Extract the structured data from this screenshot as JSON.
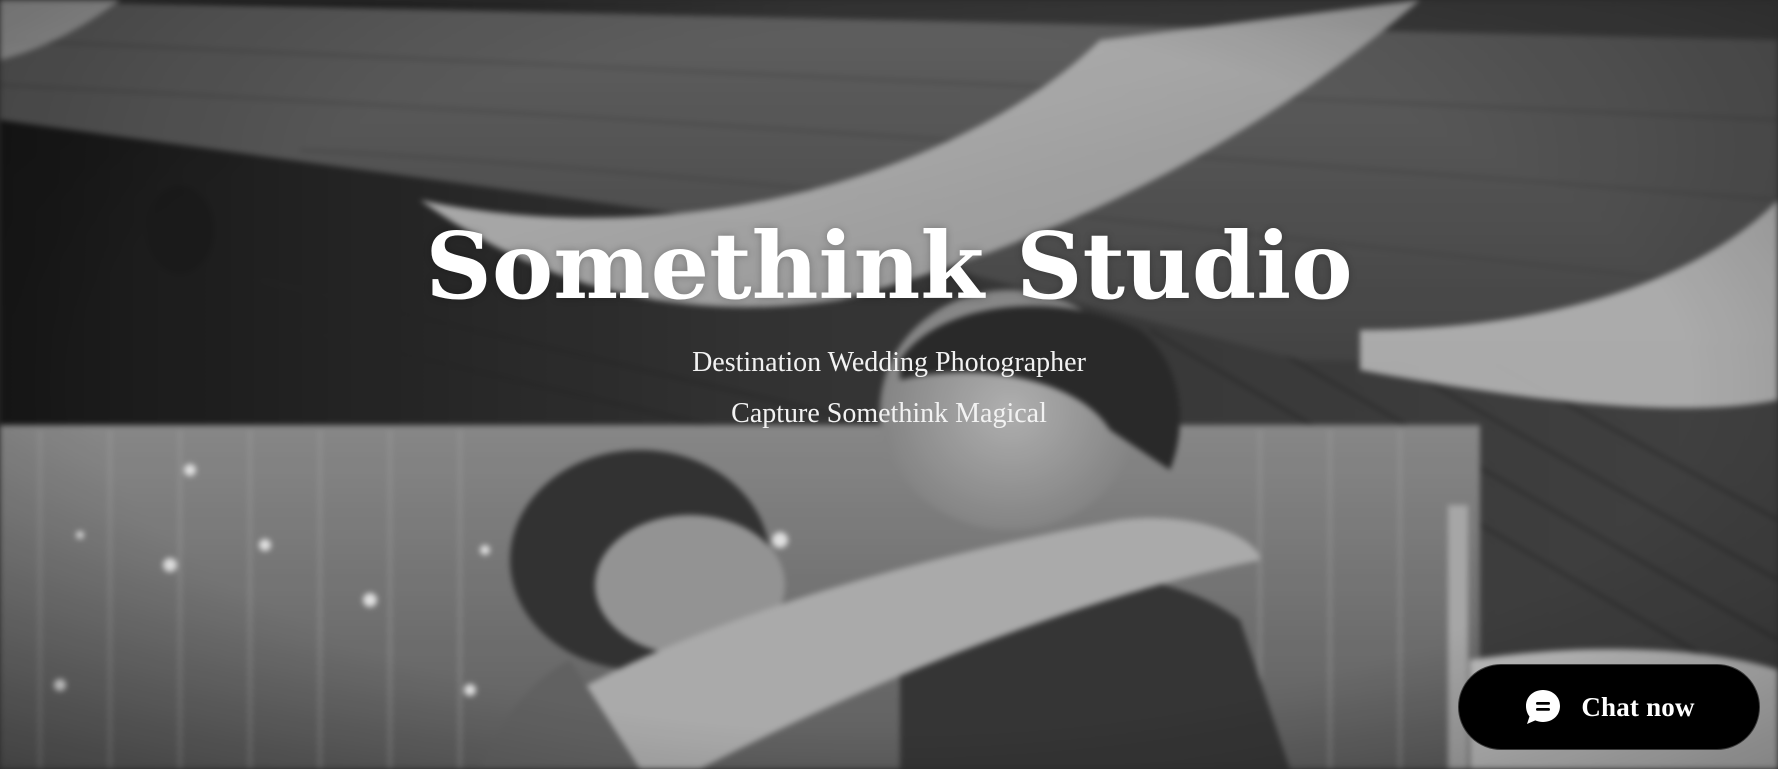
{
  "hero": {
    "title": "Somethink Studio",
    "tagline_1": "Destination Wedding Photographer",
    "tagline_2": "Capture Somethink Magical",
    "background_image": "black-and-white photo of a couple dancing under draped fabric and wooden beams"
  },
  "chat_widget": {
    "label": "Chat now",
    "icon": "chat-bubble-icon",
    "background_color": "#000000",
    "text_color": "#ffffff"
  }
}
